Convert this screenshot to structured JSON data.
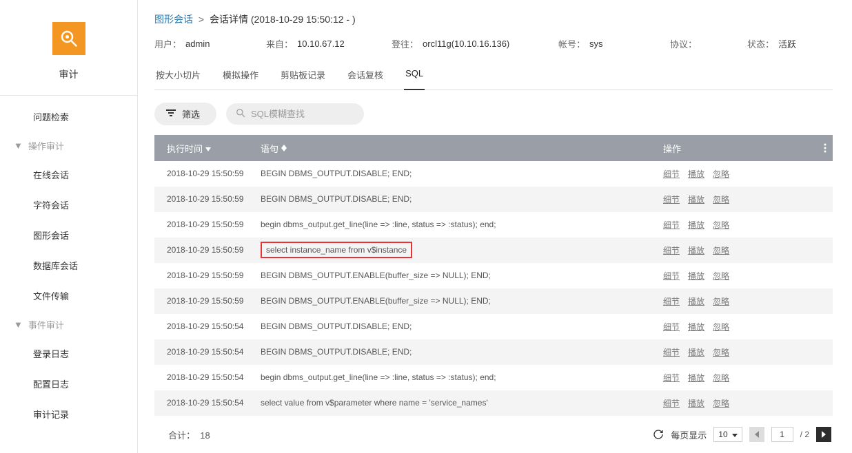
{
  "sidebar": {
    "title": "审计",
    "items": [
      {
        "label": "问题检索",
        "key": "issue-search"
      }
    ],
    "sections": [
      {
        "label": "操作审计",
        "key": "op-audit",
        "items": [
          {
            "label": "在线会话",
            "key": "online-session"
          },
          {
            "label": "字符会话",
            "key": "char-session"
          },
          {
            "label": "图形会话",
            "key": "graph-session"
          },
          {
            "label": "数据库会话",
            "key": "db-session"
          },
          {
            "label": "文件传输",
            "key": "file-transfer"
          }
        ]
      },
      {
        "label": "事件审计",
        "key": "event-audit",
        "items": [
          {
            "label": "登录日志",
            "key": "login-log"
          },
          {
            "label": "配置日志",
            "key": "config-log"
          },
          {
            "label": "审计记录",
            "key": "audit-record"
          }
        ]
      }
    ]
  },
  "breadcrumb": {
    "link": "图形会话",
    "sep": ">",
    "current": "会话详情 (2018-10-29 15:50:12 - )"
  },
  "info": {
    "user_label": "用户：",
    "user_value": "admin",
    "from_label": "来自：",
    "from_value": "10.10.67.12",
    "login_label": "登往：",
    "login_value": "orcl11g(10.10.16.136)",
    "account_label": "帐号：",
    "account_value": "sys",
    "protocol_label": "协议：",
    "protocol_value": "",
    "status_label": "状态：",
    "status_value": "活跃"
  },
  "tabs": [
    {
      "label": "按大小切片",
      "key": "slice"
    },
    {
      "label": "模拟操作",
      "key": "simulate"
    },
    {
      "label": "剪贴板记录",
      "key": "clipboard"
    },
    {
      "label": "会话复核",
      "key": "review"
    },
    {
      "label": "SQL",
      "key": "sql",
      "active": true
    }
  ],
  "toolbar": {
    "filter_label": "筛选",
    "search_placeholder": "SQL模糊查找"
  },
  "table": {
    "headers": {
      "time": "执行时间",
      "stmt": "语句",
      "ops": "操作"
    },
    "actions": {
      "detail": "细节",
      "replay": "播放",
      "ignore": "忽略"
    },
    "rows": [
      {
        "time": "2018-10-29 15:50:59",
        "stmt": "BEGIN DBMS_OUTPUT.DISABLE; END;",
        "highlight": false
      },
      {
        "time": "2018-10-29 15:50:59",
        "stmt": "BEGIN DBMS_OUTPUT.DISABLE; END;",
        "highlight": false
      },
      {
        "time": "2018-10-29 15:50:59",
        "stmt": "begin dbms_output.get_line(line => :line, status => :status); end;",
        "highlight": false
      },
      {
        "time": "2018-10-29 15:50:59",
        "stmt": "select instance_name from v$instance",
        "highlight": true
      },
      {
        "time": "2018-10-29 15:50:59",
        "stmt": "BEGIN DBMS_OUTPUT.ENABLE(buffer_size => NULL); END;",
        "highlight": false
      },
      {
        "time": "2018-10-29 15:50:59",
        "stmt": "BEGIN DBMS_OUTPUT.ENABLE(buffer_size => NULL); END;",
        "highlight": false
      },
      {
        "time": "2018-10-29 15:50:54",
        "stmt": "BEGIN DBMS_OUTPUT.DISABLE; END;",
        "highlight": false
      },
      {
        "time": "2018-10-29 15:50:54",
        "stmt": "BEGIN DBMS_OUTPUT.DISABLE; END;",
        "highlight": false
      },
      {
        "time": "2018-10-29 15:50:54",
        "stmt": "begin dbms_output.get_line(line => :line, status => :status); end;",
        "highlight": false
      },
      {
        "time": "2018-10-29 15:50:54",
        "stmt": "select value from v$parameter where name = 'service_names'",
        "highlight": false
      }
    ]
  },
  "footer": {
    "total_label": "合计：",
    "total_value": "18",
    "per_page_label": "每页显示",
    "page_size": "10",
    "current_page": "1",
    "total_pages_prefix": "/ ",
    "total_pages": "2"
  }
}
